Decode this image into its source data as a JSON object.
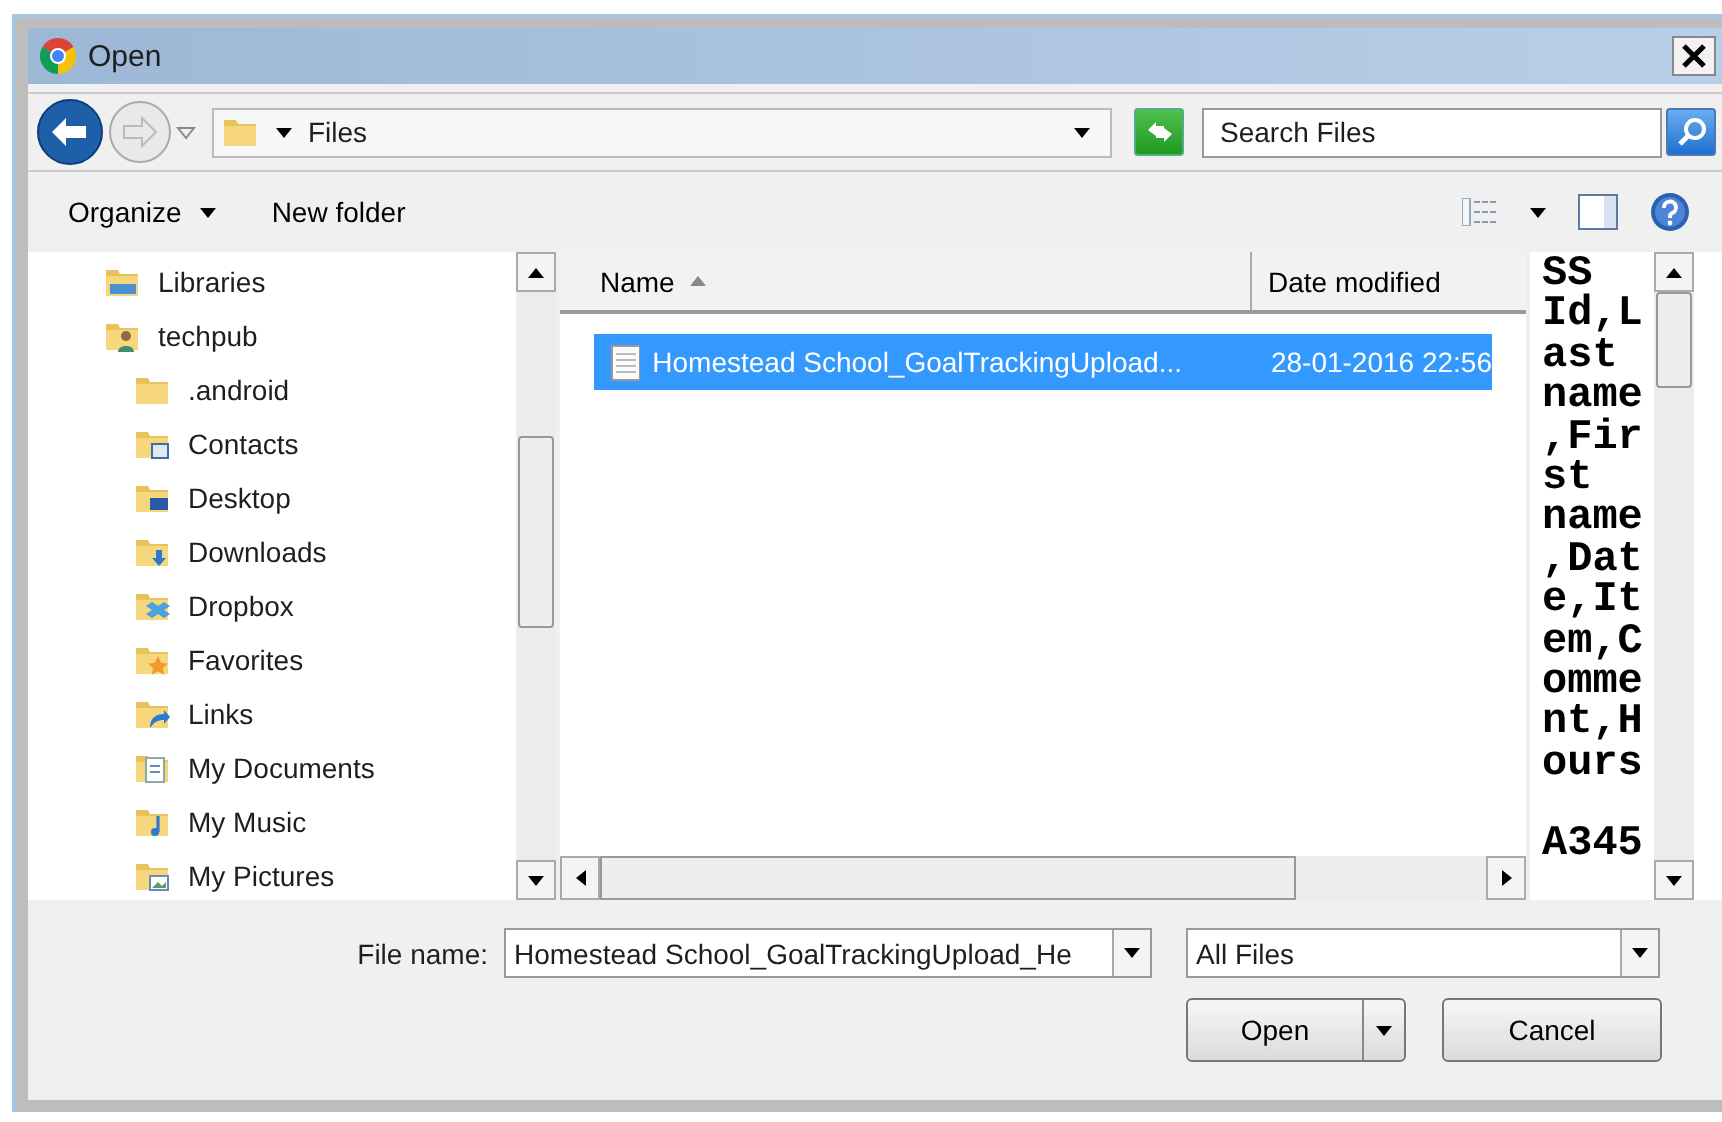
{
  "window": {
    "title": "Open"
  },
  "address_bar": {
    "path": "Files"
  },
  "search": {
    "placeholder": "Search Files"
  },
  "toolbar": {
    "items": [
      {
        "label": "Organize",
        "kind": "menu"
      },
      {
        "label": "New folder",
        "kind": "button"
      }
    ]
  },
  "navigation_tree": {
    "items": [
      {
        "label": "Libraries",
        "kind": "libraries"
      },
      {
        "label": "techpub",
        "kind": "user",
        "children": [
          {
            "label": ".android",
            "kind": "folder"
          },
          {
            "label": "Contacts",
            "kind": "contacts"
          },
          {
            "label": "Desktop",
            "kind": "desktop"
          },
          {
            "label": "Downloads",
            "kind": "downloads"
          },
          {
            "label": "Dropbox",
            "kind": "dropbox"
          },
          {
            "label": "Favorites",
            "kind": "favorites"
          },
          {
            "label": "Links",
            "kind": "links"
          },
          {
            "label": "My Documents",
            "kind": "documents"
          },
          {
            "label": "My Music",
            "kind": "music"
          },
          {
            "label": "My Pictures",
            "kind": "pictures"
          }
        ]
      }
    ]
  },
  "file_list": {
    "columns": [
      {
        "label": "Name",
        "sorted": true
      },
      {
        "label": "Date modified",
        "sorted": false
      }
    ],
    "rows": [
      {
        "name": "Homestead School_GoalTrackingUpload...",
        "date_modified": "28-01-2016 22:56",
        "selected": true
      }
    ]
  },
  "preview": {
    "paragraphs": [
      [
        "SS",
        "Id,L",
        "ast",
        "name",
        ",Fir",
        "st",
        "name",
        ",Dat",
        "e,It",
        "em,C",
        "omme",
        "nt,H",
        "ours"
      ],
      [
        "A345"
      ]
    ]
  },
  "file_name": {
    "label": "File name:",
    "value": "Homestead School_GoalTrackingUpload_He"
  },
  "file_type": {
    "value": "All Files"
  },
  "buttons": [
    {
      "label": "Open",
      "kind": "split"
    },
    {
      "label": "Cancel",
      "kind": "plain"
    }
  ]
}
